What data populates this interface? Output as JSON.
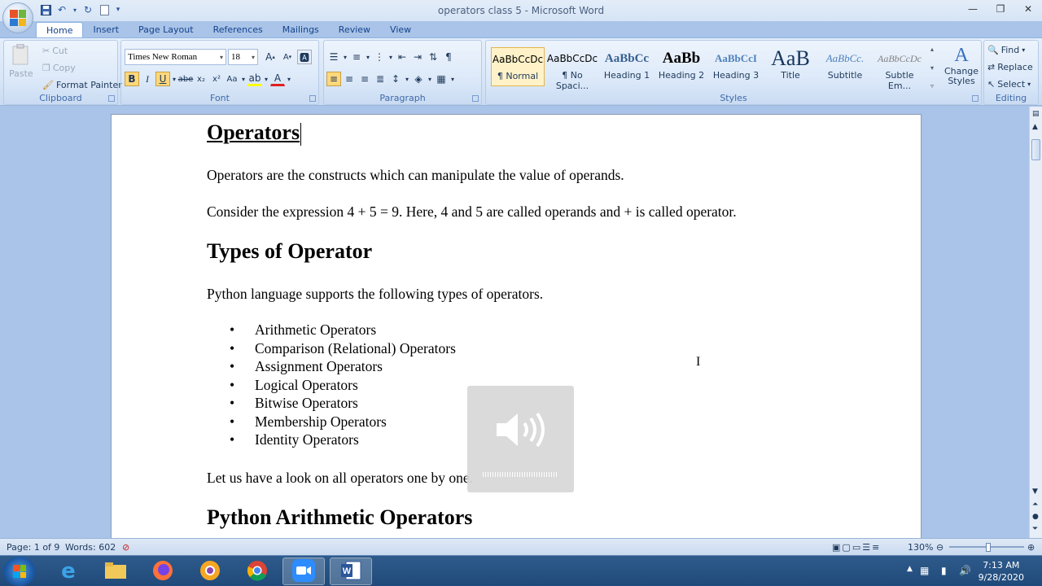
{
  "app": {
    "title": "operators class 5 - Microsoft Word"
  },
  "window_controls": {
    "minimize": "—",
    "maximize": "❐",
    "close": "✕"
  },
  "tabs": [
    "Home",
    "Insert",
    "Page Layout",
    "References",
    "Mailings",
    "Review",
    "View"
  ],
  "ribbon": {
    "clipboard": {
      "label": "Clipboard",
      "paste": "Paste",
      "cut": "Cut",
      "copy": "Copy",
      "format_painter": "Format Painter"
    },
    "font": {
      "label": "Font",
      "font_name": "Times New Roman",
      "font_size": "18"
    },
    "paragraph": {
      "label": "Paragraph"
    },
    "styles": {
      "label": "Styles",
      "items": [
        {
          "sample": "AaBbCcDc",
          "name": "¶ Normal"
        },
        {
          "sample": "AaBbCcDc",
          "name": "¶ No Spaci..."
        },
        {
          "sample": "AaBbCc",
          "name": "Heading 1"
        },
        {
          "sample": "AaBb",
          "name": "Heading 2"
        },
        {
          "sample": "AaBbCcI",
          "name": "Heading 3"
        },
        {
          "sample": "AaB",
          "name": "Title"
        },
        {
          "sample": "AaBbCc.",
          "name": "Subtitle"
        },
        {
          "sample": "AaBbCcDc",
          "name": "Subtle Em..."
        }
      ],
      "change_styles": "Change Styles"
    },
    "editing": {
      "label": "Editing",
      "find": "Find",
      "replace": "Replace",
      "select": "Select"
    }
  },
  "document": {
    "title": "Operators",
    "intro1": "Operators are the constructs which can manipulate the value of operands.",
    "intro2": "Consider the expression 4 + 5 = 9. Here, 4 and 5 are called operands and + is called operator.",
    "heading1": "Types of Operator",
    "lead": "Python language supports the following types of operators.",
    "bullets": [
      "Arithmetic Operators",
      "Comparison (Relational) Operators",
      "Assignment Operators",
      "Logical Operators",
      "Bitwise Operators",
      "Membership Operators",
      "Identity Operators"
    ],
    "outro": "Let us have a look on all operators one by one.",
    "heading2": "Python Arithmetic Operators"
  },
  "statusbar": {
    "page": "Page: 1 of 9",
    "words": "Words: 602",
    "zoom": "130%"
  },
  "taskbar": {
    "time": "7:13 AM",
    "date": "9/28/2020"
  },
  "volume_level": 1.0
}
